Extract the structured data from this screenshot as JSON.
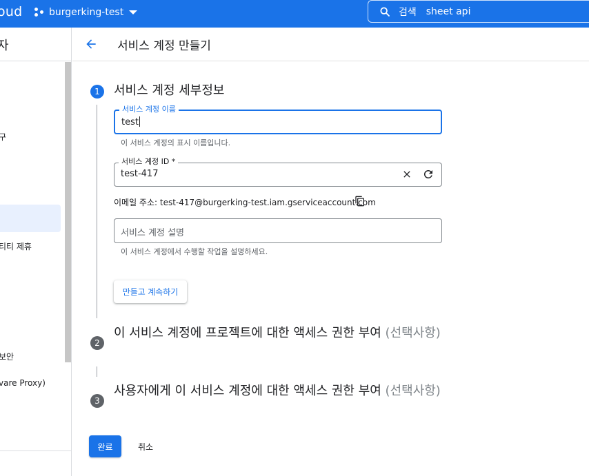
{
  "colors": {
    "accent": "#1a73e8",
    "topbar": "#1a73e8",
    "inactive_step": "#5f6368"
  },
  "topbar": {
    "brand": "oud",
    "project": "burgerking-test",
    "search_label": "검색",
    "search_value": "sheet api"
  },
  "leftnav": {
    "title": "자",
    "items": [
      "구",
      "티티 제휴",
      "보안",
      "vare Proxy)"
    ]
  },
  "header": {
    "title": "서비스 계정 만들기"
  },
  "steps": [
    {
      "number": "1",
      "title": "서비스 계정 세부정보"
    },
    {
      "number": "2",
      "title": "이 서비스 계정에 프로젝트에 대한 액세스 권한 부여",
      "optional": "(선택사항)"
    },
    {
      "number": "3",
      "title": "사용자에게 이 서비스 계정에 대한 액세스 권한 부여",
      "optional": "(선택사항)"
    }
  ],
  "form": {
    "name": {
      "label": "서비스 계정 이름",
      "value": "test",
      "hint": "이 서비스 계정의 표시 이름입니다."
    },
    "id": {
      "label": "서비스 계정 ID *",
      "value": "test-417"
    },
    "email": "이메일 주소: test-417@burgerking-test.iam.gserviceaccount.com",
    "description": {
      "placeholder": "서비스 계정 설명",
      "hint": "이 서비스 계정에서 수행할 작업을 설명하세요."
    }
  },
  "buttons": {
    "continue": "만들고 계속하기",
    "done": "완료",
    "cancel": "취소"
  },
  "icons": [
    "project-icon",
    "dropdown-caret-icon",
    "search-icon",
    "back-arrow-icon",
    "clear-icon",
    "refresh-icon",
    "copy-icon"
  ]
}
